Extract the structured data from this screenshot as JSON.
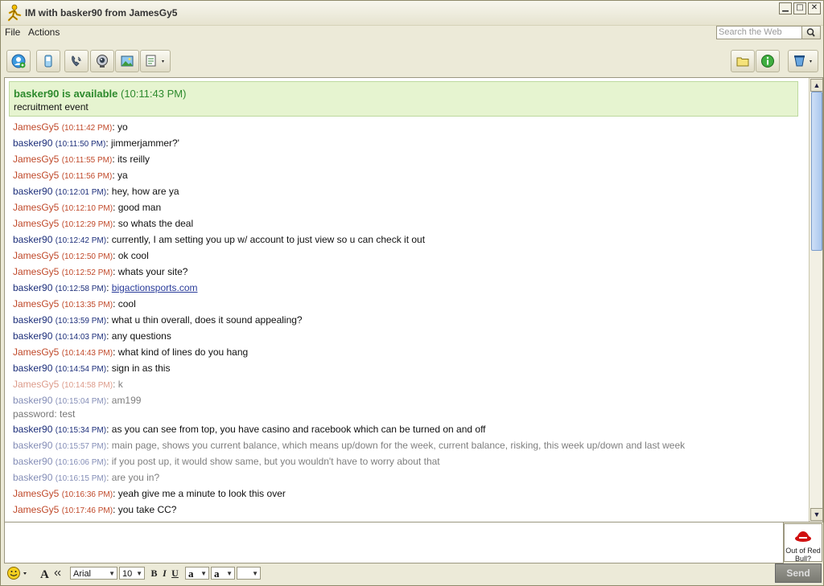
{
  "window": {
    "title": "IM with basker90 from JamesGy5",
    "minimize_glyph": "▁",
    "maximize_glyph": "□",
    "close_glyph": "✕"
  },
  "menu": {
    "file": "File",
    "actions": "Actions",
    "search_placeholder": "Search the Web"
  },
  "toolbar": {
    "icons": [
      "add-buddy-icon",
      "mobile-icon",
      "call-icon",
      "webcam-icon",
      "picture-icon",
      "send-file-icon",
      "folder-icon",
      "info-icon",
      "settings-icon"
    ]
  },
  "status": {
    "name": "basker90 is available",
    "time": "(10:11:43 PM)",
    "message": "recruitment event"
  },
  "messages": [
    {
      "sender": "JamesGy5",
      "time": "(10:11:42 PM)",
      "text": "yo",
      "who": "me",
      "faded": false
    },
    {
      "sender": "basker90",
      "time": "(10:11:50 PM)",
      "text": "jimmerjammer?'",
      "who": "them",
      "faded": false
    },
    {
      "sender": "JamesGy5",
      "time": "(10:11:55 PM)",
      "text": "its reilly",
      "who": "me",
      "faded": false
    },
    {
      "sender": "JamesGy5",
      "time": "(10:11:56 PM)",
      "text": "ya",
      "who": "me",
      "faded": false
    },
    {
      "sender": "basker90",
      "time": "(10:12:01 PM)",
      "text": "hey, how are ya",
      "who": "them",
      "faded": false
    },
    {
      "sender": "JamesGy5",
      "time": "(10:12:10 PM)",
      "text": "good man",
      "who": "me",
      "faded": false
    },
    {
      "sender": "JamesGy5",
      "time": "(10:12:29 PM)",
      "text": "so whats the deal",
      "who": "me",
      "faded": false
    },
    {
      "sender": "basker90",
      "time": "(10:12:42 PM)",
      "text": "currently, I am setting you up w/ account to just view so u can check it out",
      "who": "them",
      "faded": false
    },
    {
      "sender": "JamesGy5",
      "time": "(10:12:50 PM)",
      "text": "ok cool",
      "who": "me",
      "faded": false
    },
    {
      "sender": "JamesGy5",
      "time": "(10:12:52 PM)",
      "text": "whats your site?",
      "who": "me",
      "faded": false
    },
    {
      "sender": "basker90",
      "time": "(10:12:58 PM)",
      "text": "bigactionsports.com",
      "who": "them",
      "faded": false,
      "link": true
    },
    {
      "sender": "JamesGy5",
      "time": "(10:13:35 PM)",
      "text": "cool",
      "who": "me",
      "faded": false
    },
    {
      "sender": "basker90",
      "time": "(10:13:59 PM)",
      "text": "what u thin overall, does it sound appealing?",
      "who": "them",
      "faded": false
    },
    {
      "sender": "basker90",
      "time": "(10:14:03 PM)",
      "text": "any questions",
      "who": "them",
      "faded": false
    },
    {
      "sender": "JamesGy5",
      "time": "(10:14:43 PM)",
      "text": "what kind of lines do you hang",
      "who": "me",
      "faded": false
    },
    {
      "sender": "basker90",
      "time": "(10:14:54 PM)",
      "text": "sign in as this",
      "who": "them",
      "faded": false
    },
    {
      "sender": "JamesGy5",
      "time": "(10:14:58 PM)",
      "text": "k",
      "who": "me",
      "faded": true
    },
    {
      "sender": "basker90",
      "time": "(10:15:04 PM)",
      "text": "am199",
      "who": "them",
      "faded": true,
      "continuation": "password: test"
    },
    {
      "sender": "basker90",
      "time": "(10:15:34 PM)",
      "text": "as you can see from top, you have casino and racebook which can be turned on and off",
      "who": "them",
      "faded": false
    },
    {
      "sender": "basker90",
      "time": "(10:15:57 PM)",
      "text": "main page, shows you current balance, which means up/down for the week, current balance, risking, this week up/down and last week",
      "who": "them",
      "faded": true
    },
    {
      "sender": "basker90",
      "time": "(10:16:06 PM)",
      "text": "if you post up, it would show same, but you wouldn't have to worry about that",
      "who": "them",
      "faded": true
    },
    {
      "sender": "basker90",
      "time": "(10:16:15 PM)",
      "text": "are you in?",
      "who": "them",
      "faded": true
    },
    {
      "sender": "JamesGy5",
      "time": "(10:16:36 PM)",
      "text": "yeah give me a minute to look this over",
      "who": "me",
      "faded": false
    },
    {
      "sender": "JamesGy5",
      "time": "(10:17:46 PM)",
      "text": "you take CC?",
      "who": "me",
      "faded": false
    }
  ],
  "ad": {
    "text": "Out of Red Bull?"
  },
  "format": {
    "font": "Arial",
    "size": "10",
    "bold": "B",
    "italic": "I",
    "underline": "U",
    "text_color": "a",
    "bg_color": "a",
    "send": "Send"
  }
}
